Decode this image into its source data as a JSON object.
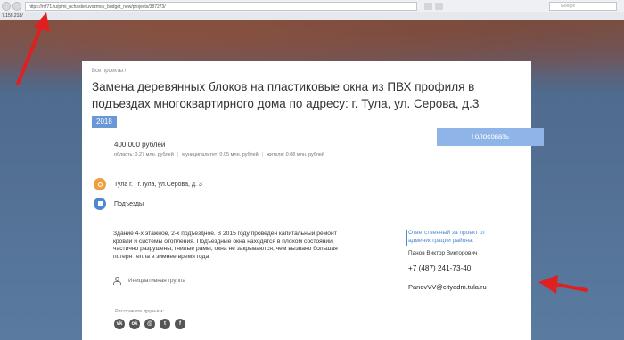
{
  "browser": {
    "url": "https://mf71.ru/pimi_uchastie/uvozmoy_budget_new/projects/387273/",
    "search_placeholder": "Google",
    "bookmark_text": "7.159.218/"
  },
  "breadcrumb": "Все проекты /",
  "title": "Замена деревянных блоков на пластиковые окна из ПВХ профиля в подъездах многоквартирного дома по адресу: г. Тула, ул. Серова, д.3",
  "year": "2018",
  "budget": {
    "amount": "400 000 рублей",
    "region": "область: 0.27 млн. рублей",
    "municipality": "муниципалитет: 0.05 млн. рублей",
    "residents": "жители: 0.08 млн. рублей"
  },
  "vote_button": "Голосовать",
  "address": "Тула г. , г.Тула, ул.Серова, д. 3",
  "category": "Подъезды",
  "description": "Здание 4-х этажное, 2-х подъездное. В 2015 году проведен капитальный ремонт кровли и системы отопления. Подъездные окна находятся в плохом состоянии, частично разрушены, гнилые рамы, окна не закрываются, чем вызвано большая потеря тепла в зимнее время года",
  "initiative_group": "Инициативная группа",
  "share": {
    "label": "Расскажите друзьям:",
    "networks": [
      "vk",
      "ok",
      "mm",
      "tw",
      "fb"
    ],
    "glyphs": [
      "vk",
      "ok",
      "@",
      "t",
      "f"
    ]
  },
  "contact": {
    "heading": "Ответственный за проект от администрации района:",
    "name": "Панов Виктор Викторович",
    "phone": "+7 (487) 241-73-40",
    "email": "PanovVV@cityadm.tula.ru"
  },
  "colors": {
    "accent_blue": "#4f88cf",
    "vote_button": "#8fb4e8",
    "year_badge": "#6a97d6",
    "address_icon": "#eea040",
    "annotation_arrow": "#e02020"
  }
}
